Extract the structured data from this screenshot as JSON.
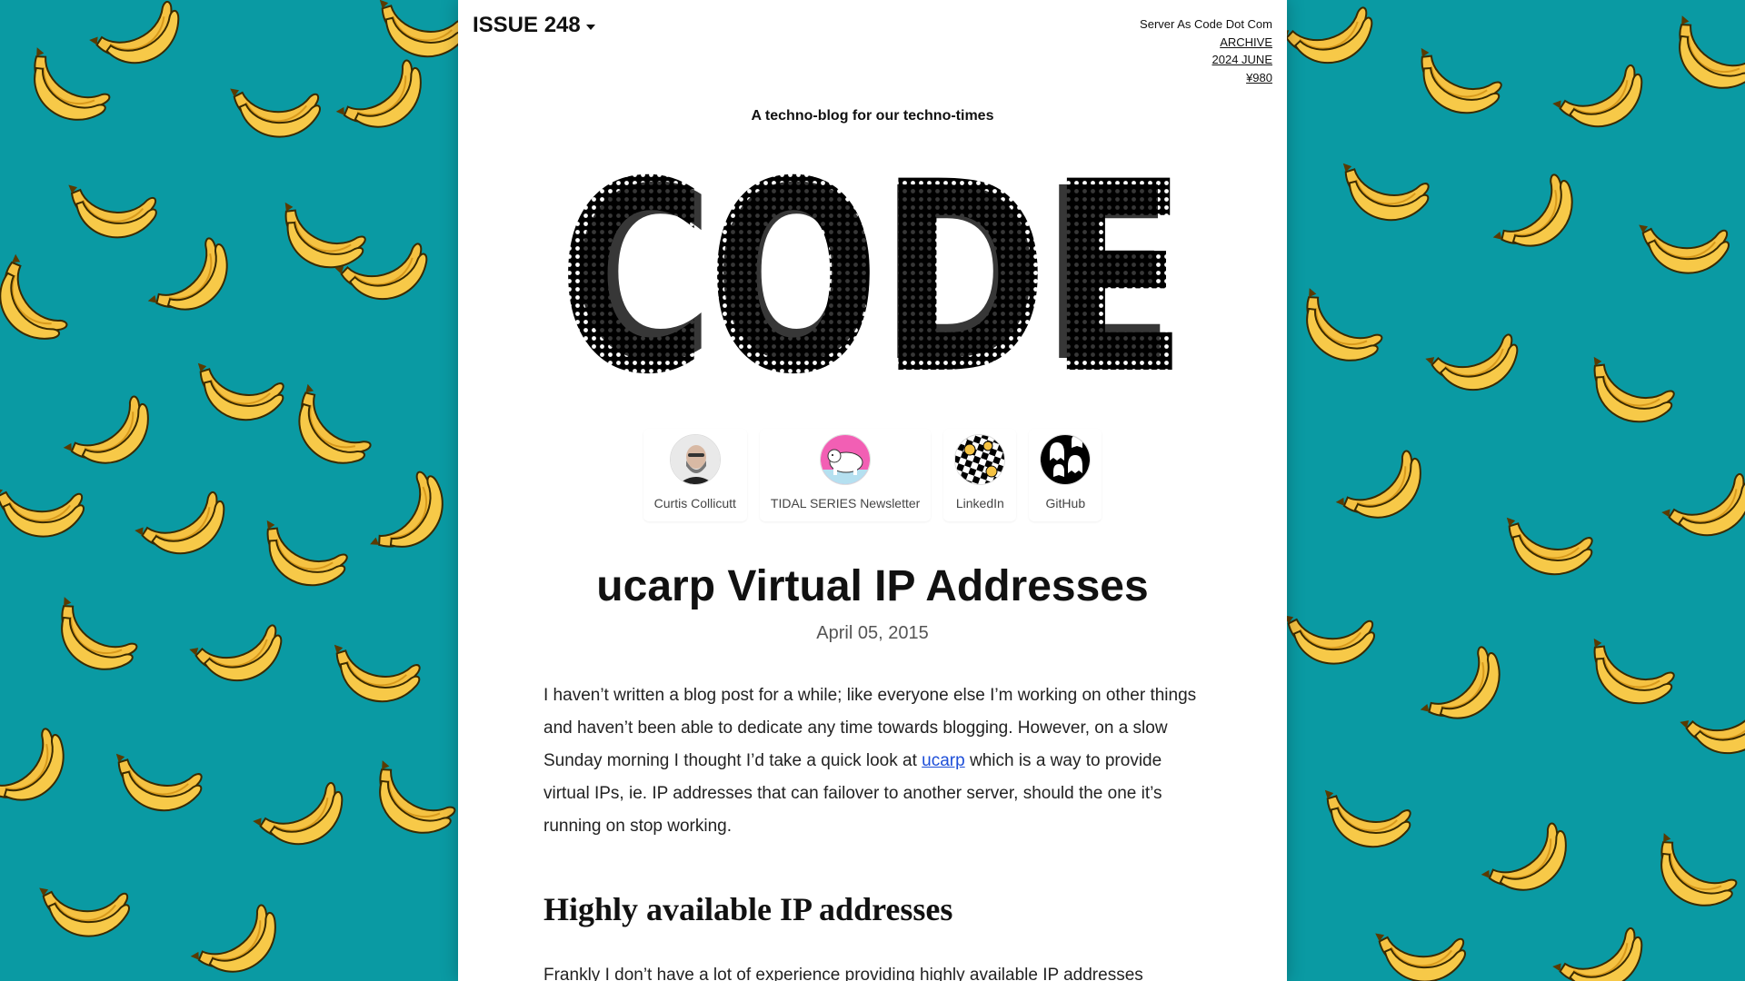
{
  "header": {
    "issue_label": "ISSUE 248",
    "site_name": "Server As Code Dot Com",
    "archive_label": "ARCHIVE",
    "edition_label": "2024 JUNE",
    "price_label": "¥980"
  },
  "tagline": "A techno-blog for our techno-times",
  "logo_text": "CODE",
  "socials": [
    {
      "label": "Curtis Collicutt",
      "icon": "person-avatar"
    },
    {
      "label": "TIDAL SERIES Newsletter",
      "icon": "polar-bear-avatar"
    },
    {
      "label": "LinkedIn",
      "icon": "checker-smiley-avatar"
    },
    {
      "label": "GitHub",
      "icon": "ghost-pattern-avatar"
    }
  ],
  "article": {
    "title": "ucarp Virtual IP Addresses",
    "date": "April 05, 2015",
    "intro_before_link": "I haven’t written a blog post for a while; like everyone else I’m working on other things and haven’t been able to dedicate any time towards blogging. However, on a slow Sunday morning I thought I’d take a quick look at ",
    "intro_link": "ucarp",
    "intro_after_link": " which is a way to provide virtual IPs, ie. IP addresses that can failover to another server, should the one it’s running on stop working.",
    "section_heading": "Highly available IP addresses",
    "section_text": "Frankly I don’t have a lot of experience providing highly available IP addresses"
  },
  "colors": {
    "background": "#0a9aa3",
    "banana": "#f5c242",
    "link": "#1d4ed8"
  }
}
